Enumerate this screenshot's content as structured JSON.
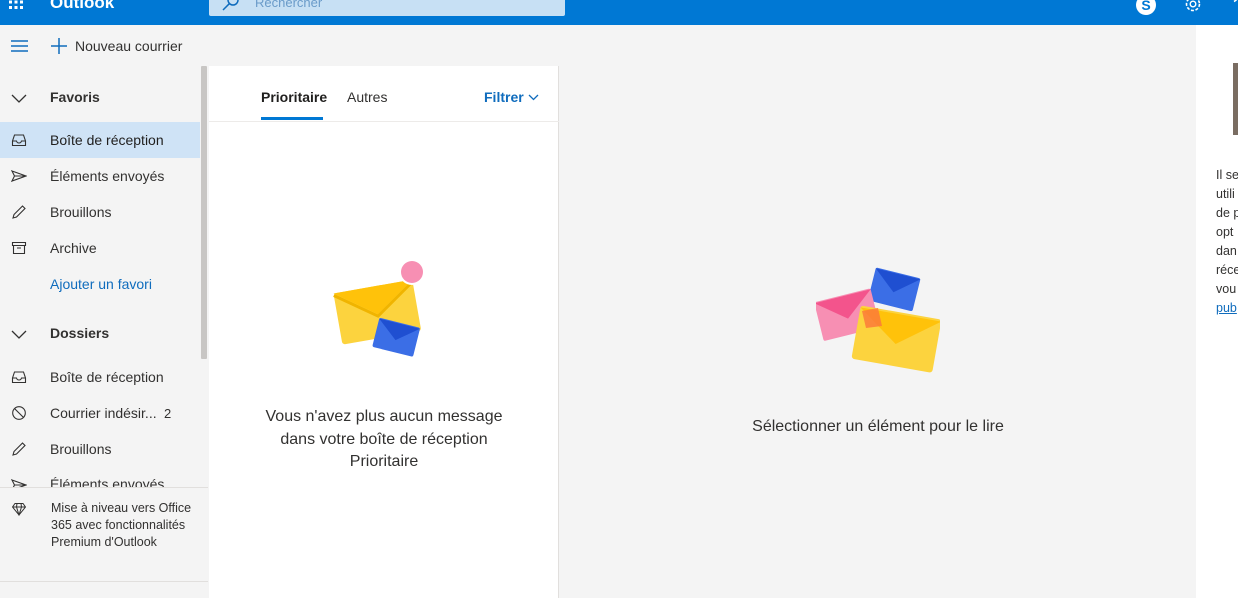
{
  "topbar": {
    "app_title": "Outlook",
    "search_placeholder": "Rechercher",
    "icons": [
      "waffle-icon",
      "search-icon",
      "skype-icon",
      "gear-icon",
      "help-icon"
    ],
    "color": "#0078d4"
  },
  "command_bar": {
    "new_mail_label": "Nouveau courrier"
  },
  "folder_pane": {
    "favorites_header": "Favoris",
    "favorites": [
      {
        "label": "Boîte de réception",
        "icon": "inbox-icon",
        "active": true
      },
      {
        "label": "Éléments envoyés",
        "icon": "send-icon"
      },
      {
        "label": "Brouillons",
        "icon": "pencil-icon"
      },
      {
        "label": "Archive",
        "icon": "archive-icon"
      }
    ],
    "add_favorite_label": "Ajouter un favori",
    "folders_header": "Dossiers",
    "folders": [
      {
        "label": "Boîte de réception",
        "icon": "inbox-icon"
      },
      {
        "label": "Courrier indésir...",
        "icon": "blocked-icon",
        "count": "2"
      },
      {
        "label": "Brouillons",
        "icon": "pencil-icon"
      },
      {
        "label": "Éléments envoyés",
        "icon": "send-icon"
      }
    ],
    "upgrade_text": "Mise à niveau vers Office 365 avec fonctionnalités Premium d'Outlook",
    "upgrade_icon": "diamond-icon"
  },
  "message_list": {
    "tabs": [
      {
        "label": "Prioritaire",
        "active": true
      },
      {
        "label": "Autres"
      }
    ],
    "filter_label": "Filtrer",
    "empty_message": "Vous n'avez plus aucun message dans votre boîte de réception Prioritaire"
  },
  "reading_pane": {
    "message": "Sélectionner un élément pour le lire"
  },
  "ad_column": {
    "lines": [
      "Il se",
      "utili",
      "de p",
      "opt",
      "dan",
      "réce",
      "vou"
    ],
    "link_text": "pub"
  }
}
